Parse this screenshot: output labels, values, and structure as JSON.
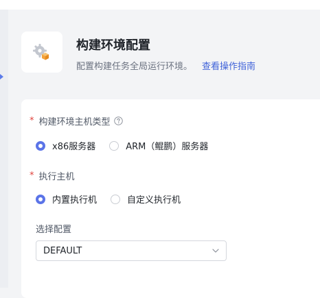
{
  "header": {
    "title": "构建环境配置",
    "description": "配置构建任务全局运行环境。",
    "guide_link": "查看操作指南",
    "icon": "gear-cube-icon"
  },
  "form": {
    "host_type": {
      "label": "构建环境主机类型",
      "required_mark": "*",
      "options": [
        {
          "label": "x86服务器",
          "checked": true
        },
        {
          "label": "ARM（鲲鹏）服务器",
          "checked": false
        }
      ]
    },
    "executor": {
      "label": "执行主机",
      "required_mark": "*",
      "options": [
        {
          "label": "内置执行机",
          "checked": true
        },
        {
          "label": "自定义执行机",
          "checked": false
        }
      ]
    },
    "config": {
      "label": "选择配置",
      "value": "DEFAULT"
    }
  },
  "colors": {
    "accent": "#5b74e8",
    "link": "#3f62d9",
    "required": "#e0433c"
  }
}
